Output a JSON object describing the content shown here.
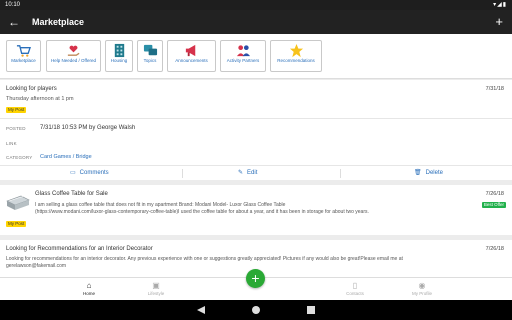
{
  "status": {
    "time": "10:10",
    "icons": "▾◢▮"
  },
  "appbar": {
    "back": "←",
    "title": "Marketplace",
    "add": "+"
  },
  "categories": [
    {
      "label": "Marketplace",
      "icon": "cart-icon"
    },
    {
      "label": "Help Needed / Offered",
      "icon": "helping-hand-icon"
    },
    {
      "label": "Housing",
      "icon": "building-icon"
    },
    {
      "label": "Topics",
      "icon": "chat-bubbles-icon"
    },
    {
      "label": "Announcements",
      "icon": "megaphone-icon"
    },
    {
      "label": "Activity Partners",
      "icon": "people-icon"
    },
    {
      "label": "Recommendations",
      "icon": "star-icon"
    }
  ],
  "posts": [
    {
      "title": "Looking for players",
      "subtitle": "Thursday afternoon at 1 pm",
      "date": "7/31/18",
      "badge": "My Post",
      "posted_label": "POSTED",
      "posted_value": "7/31/18 10:53 PM by George Walsh",
      "link_label": "LINK",
      "category_label": "CATEGORY",
      "category_value": "Card Games / Bridge",
      "actions": {
        "comments": "Comments",
        "edit": "Edit",
        "delete": "Delete"
      }
    },
    {
      "title": "Glass Coffee Table for Sale",
      "body_line1": "I am selling a glass coffee table that does not fit in my apartment Brand: Modani Model- Luxor Glass Coffee Table",
      "body_line2": "(https://www.modani.com/luxor-glass-contemporary-coffee-table)I used the coffee table for about a year, and it has been in storage for about two years.",
      "date": "7/26/18",
      "badge_best": "Best Offer",
      "badge": "My Post"
    },
    {
      "title": "Looking for Recommendations for an Interior Decorator",
      "body_line1": "Looking for recommendations for an interior decorator. Any previous experience with one or suggestions greatly appreciated! Pictures if any would also be great!Please email me at",
      "body_line2": "gerelawson@fakemail.com",
      "date": "7/26/18"
    }
  ],
  "bottom_nav": [
    {
      "label": "Home",
      "icon": "home-icon",
      "active": true
    },
    {
      "label": "Lifestyle",
      "icon": "bag-icon",
      "active": false
    },
    {
      "label": "Contacts",
      "icon": "contacts-icon",
      "active": false
    },
    {
      "label": "My Profile",
      "icon": "profile-icon",
      "active": false
    }
  ],
  "fab": "+",
  "colors": {
    "appbar": "#222222",
    "accent": "#2a6fba",
    "badge": "#ffd400",
    "best_offer": "#22b14c",
    "fab": "#2aa935"
  }
}
